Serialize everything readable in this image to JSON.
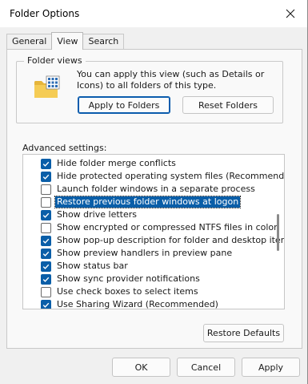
{
  "window": {
    "title": "Folder Options"
  },
  "tabs": [
    {
      "label": "General",
      "active": false
    },
    {
      "label": "View",
      "active": true
    },
    {
      "label": "Search",
      "active": false
    }
  ],
  "folder_views": {
    "group_label": "Folder views",
    "description": "You can apply this view (such as Details or Icons) to all folders of this type.",
    "apply_button": "Apply to Folders",
    "reset_button": "Reset Folders"
  },
  "advanced": {
    "label": "Advanced settings:",
    "items": [
      {
        "label": "Hide folder merge conflicts",
        "checked": true,
        "selected": false
      },
      {
        "label": "Hide protected operating system files (Recommended)",
        "checked": true,
        "selected": false
      },
      {
        "label": "Launch folder windows in a separate process",
        "checked": false,
        "selected": false
      },
      {
        "label": "Restore previous folder windows at logon",
        "checked": false,
        "selected": true
      },
      {
        "label": "Show drive letters",
        "checked": true,
        "selected": false
      },
      {
        "label": "Show encrypted or compressed NTFS files in color",
        "checked": false,
        "selected": false
      },
      {
        "label": "Show pop-up description for folder and desktop items",
        "checked": true,
        "selected": false
      },
      {
        "label": "Show preview handlers in preview pane",
        "checked": true,
        "selected": false
      },
      {
        "label": "Show status bar",
        "checked": true,
        "selected": false
      },
      {
        "label": "Show sync provider notifications",
        "checked": true,
        "selected": false
      },
      {
        "label": "Use check boxes to select items",
        "checked": false,
        "selected": false
      },
      {
        "label": "Use Sharing Wizard (Recommended)",
        "checked": true,
        "selected": false
      }
    ],
    "restore_defaults": "Restore Defaults"
  },
  "footer": {
    "ok": "OK",
    "cancel": "Cancel",
    "apply": "Apply"
  },
  "colors": {
    "accent": "#0a5ea8",
    "window_bg": "#f0f0f0",
    "panel_bg": "#f9f9f9"
  },
  "icons": {
    "close": "close-icon",
    "folder": "folder-view-icon",
    "check": "checkmark-icon"
  }
}
